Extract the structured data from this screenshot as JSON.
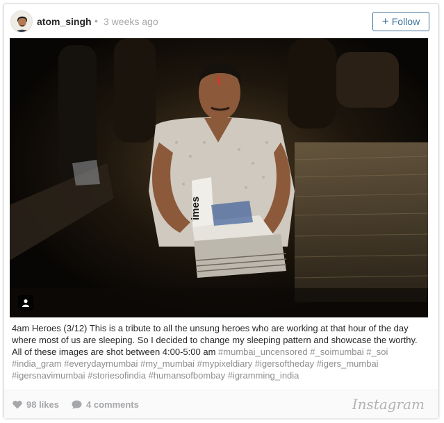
{
  "post": {
    "username": "atom_singh",
    "separator": "•",
    "time_ago": "3 weeks ago",
    "follow_label": "Follow",
    "follow_icon": "plus-icon"
  },
  "caption": {
    "text": "4am Heroes (3/12) This is a tribute to all the unsung heroes who are working at that hour of the day where most of us are sleeping. So I decided to change my sleeping pattern and showcase the worthy. All of these images are shot between 4:00-5:00 am",
    "hashtags": [
      "#mumbai_uncensored",
      "#_soimumbai",
      "#_soi",
      "#india_gram",
      "#everydaymumbai",
      "#my_mumbai",
      "#mypixeldiary",
      "#igersoftheday",
      "#igers_mumbai",
      "#igersnavimumbai",
      "#storiesofindia",
      "#humansofbombay",
      "#igramming_india"
    ]
  },
  "photo": {
    "newspaper_text": "imes"
  },
  "footer": {
    "likes": "98 likes",
    "comments": "4 comments",
    "brand": "Instagram"
  },
  "colors": {
    "link_blue": "#3f729b",
    "muted_gray": "#a5a7aa",
    "hashtag_gray": "#8e8e8e"
  }
}
